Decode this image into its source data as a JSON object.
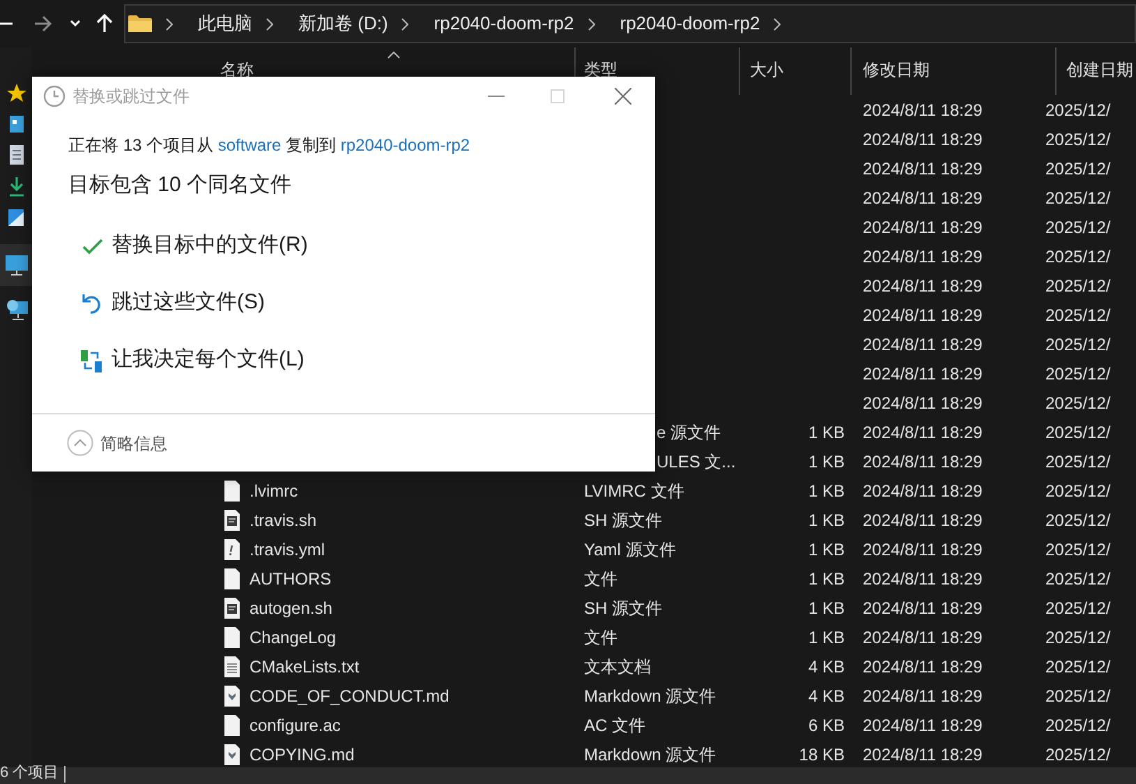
{
  "nav": {
    "path": [
      "此电脑",
      "新加卷 (D:)",
      "rp2040-doom-rp2",
      "rp2040-doom-rp2"
    ]
  },
  "columns": [
    "名称",
    "类型",
    "大小",
    "修改日期",
    "创建日期"
  ],
  "rows": [
    {
      "modified": "2024/8/11 18:29",
      "created": "2025/12/"
    },
    {
      "modified": "2024/8/11 18:29",
      "created": "2025/12/"
    },
    {
      "modified": "2024/8/11 18:29",
      "created": "2025/12/"
    },
    {
      "modified": "2024/8/11 18:29",
      "created": "2025/12/"
    },
    {
      "modified": "2024/8/11 18:29",
      "created": "2025/12/"
    },
    {
      "modified": "2024/8/11 18:29",
      "created": "2025/12/"
    },
    {
      "modified": "2024/8/11 18:29",
      "created": "2025/12/"
    },
    {
      "modified": "2024/8/11 18:29",
      "created": "2025/12/"
    },
    {
      "modified": "2024/8/11 18:29",
      "created": "2025/12/"
    },
    {
      "modified": "2024/8/11 18:29",
      "created": "2025/12/"
    },
    {
      "modified": "2024/8/11 18:29",
      "created": "2025/12/"
    },
    {
      "type": "e 源文件",
      "size": "1 KB",
      "modified": "2024/8/11 18:29",
      "created": "2025/12/"
    },
    {
      "type": "ULES 文...",
      "size": "1 KB",
      "modified": "2024/8/11 18:29",
      "created": "2025/12/"
    },
    {
      "kind": "file",
      "name": ".lvimrc",
      "type": "LVIMRC 文件",
      "size": "1 KB",
      "modified": "2024/8/11 18:29",
      "created": "2025/12/"
    },
    {
      "kind": "script",
      "name": ".travis.sh",
      "type": "SH 源文件",
      "size": "1 KB",
      "modified": "2024/8/11 18:29",
      "created": "2025/12/"
    },
    {
      "kind": "yaml",
      "name": ".travis.yml",
      "type": "Yaml 源文件",
      "size": "1 KB",
      "modified": "2024/8/11 18:29",
      "created": "2025/12/"
    },
    {
      "kind": "file",
      "name": "AUTHORS",
      "type": "文件",
      "size": "1 KB",
      "modified": "2024/8/11 18:29",
      "created": "2025/12/"
    },
    {
      "kind": "script",
      "name": "autogen.sh",
      "type": "SH 源文件",
      "size": "1 KB",
      "modified": "2024/8/11 18:29",
      "created": "2025/12/"
    },
    {
      "kind": "file",
      "name": "ChangeLog",
      "type": "文件",
      "size": "1 KB",
      "modified": "2024/8/11 18:29",
      "created": "2025/12/"
    },
    {
      "kind": "text",
      "name": "CMakeLists.txt",
      "type": "文本文档",
      "size": "4 KB",
      "modified": "2024/8/11 18:29",
      "created": "2025/12/"
    },
    {
      "kind": "markdown",
      "name": "CODE_OF_CONDUCT.md",
      "type": "Markdown 源文件",
      "size": "4 KB",
      "modified": "2024/8/11 18:29",
      "created": "2025/12/"
    },
    {
      "kind": "file",
      "name": "configure.ac",
      "type": "AC 文件",
      "size": "6 KB",
      "modified": "2024/8/11 18:29",
      "created": "2025/12/"
    },
    {
      "kind": "markdown",
      "name": "COPYING.md",
      "type": "Markdown 源文件",
      "size": "18 KB",
      "modified": "2024/8/11 18:29",
      "created": "2025/12/"
    }
  ],
  "status_bar": "6 个项目",
  "dialog": {
    "title": "替换或跳过文件",
    "copy_line": {
      "prefix": "正在将 13 个项目从",
      "source": "software",
      "middle": "复制到",
      "target": "rp2040-doom-rp2"
    },
    "heading": "目标包含 10 个同名文件",
    "options": [
      {
        "kind": "replace",
        "label": "替换目标中的文件(R)"
      },
      {
        "kind": "skip",
        "label": "跳过这些文件(S)"
      },
      {
        "kind": "decide",
        "label": "让我决定每个文件(L)"
      }
    ],
    "details": "简略信息"
  }
}
